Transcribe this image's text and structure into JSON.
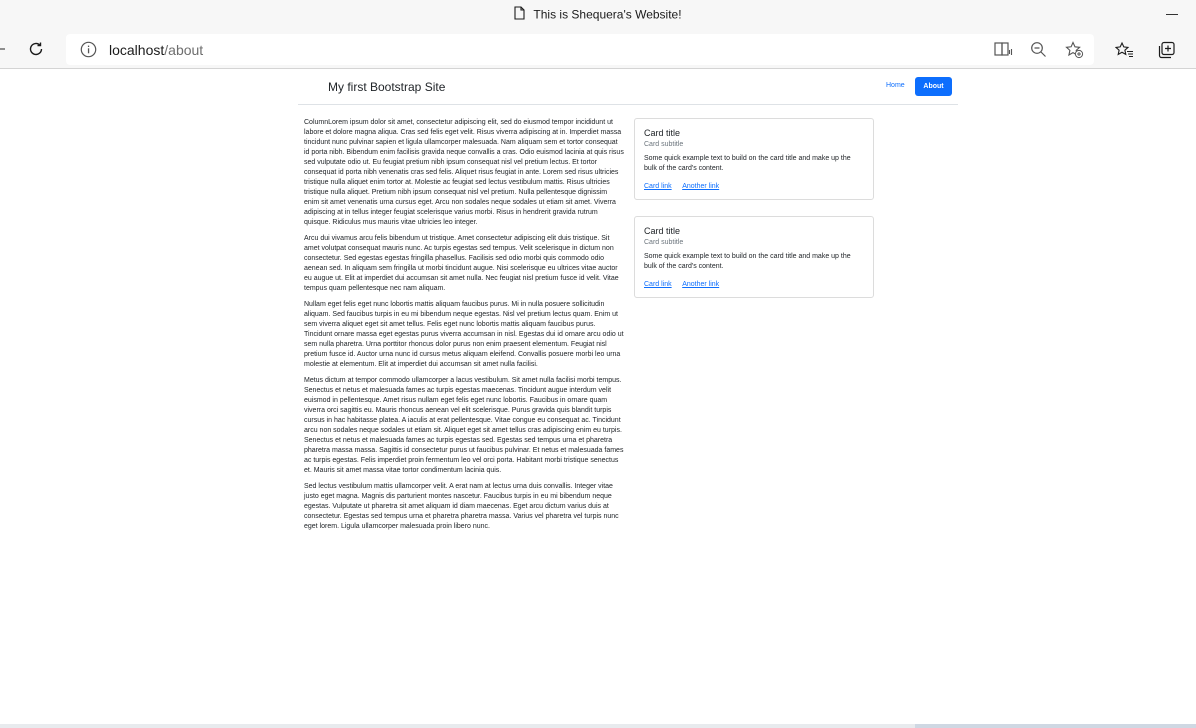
{
  "browser": {
    "tab_title": "This is Shequera's Website!",
    "url_host": "localhost",
    "url_path": "/about"
  },
  "navbar": {
    "brand": "My first Bootstrap Site",
    "home": "Home",
    "about": "About"
  },
  "content": {
    "paragraphs": [
      "ColumnLorem ipsum dolor sit amet, consectetur adipiscing elit, sed do eiusmod tempor incididunt ut labore et dolore magna aliqua. Cras sed felis eget velit. Risus viverra adipiscing at in. Imperdiet massa tincidunt nunc pulvinar sapien et ligula ullamcorper malesuada. Nam aliquam sem et tortor consequat id porta nibh. Bibendum enim facilisis gravida neque convallis a cras. Odio euismod lacinia at quis risus sed vulputate odio ut. Eu feugiat pretium nibh ipsum consequat nisl vel pretium lectus. Et tortor consequat id porta nibh venenatis cras sed felis. Aliquet risus feugiat in ante. Lorem sed risus ultricies tristique nulla aliquet enim tortor at. Molestie ac feugiat sed lectus vestibulum mattis. Risus ultricies tristique nulla aliquet. Pretium nibh ipsum consequat nisl vel pretium. Nulla pellentesque dignissim enim sit amet venenatis urna cursus eget. Arcu non sodales neque sodales ut etiam sit amet. Viverra adipiscing at in tellus integer feugiat scelerisque varius morbi. Risus in hendrerit gravida rutrum quisque. Ridiculus mus mauris vitae ultricies leo integer.",
      "Arcu dui vivamus arcu felis bibendum ut tristique. Amet consectetur adipiscing elit duis tristique. Sit amet volutpat consequat mauris nunc. Ac turpis egestas sed tempus. Velit scelerisque in dictum non consectetur. Sed egestas egestas fringilla phasellus. Facilisis sed odio morbi quis commodo odio aenean sed. In aliquam sem fringilla ut morbi tincidunt augue. Nisi scelerisque eu ultrices vitae auctor eu augue ut. Elit at imperdiet dui accumsan sit amet nulla. Nec feugiat nisl pretium fusce id velit. Vitae tempus quam pellentesque nec nam aliquam.",
      "Nullam eget felis eget nunc lobortis mattis aliquam faucibus purus. Mi in nulla posuere sollicitudin aliquam. Sed faucibus turpis in eu mi bibendum neque egestas. Nisl vel pretium lectus quam. Enim ut sem viverra aliquet eget sit amet tellus. Felis eget nunc lobortis mattis aliquam faucibus purus. Tincidunt ornare massa eget egestas purus viverra accumsan in nisl. Egestas dui id ornare arcu odio ut sem nulla pharetra. Urna porttitor rhoncus dolor purus non enim praesent elementum. Feugiat nisl pretium fusce id. Auctor urna nunc id cursus metus aliquam eleifend. Convallis posuere morbi leo urna molestie at elementum. Elit at imperdiet dui accumsan sit amet nulla facilisi.",
      "Metus dictum at tempor commodo ullamcorper a lacus vestibulum. Sit amet nulla facilisi morbi tempus. Senectus et netus et malesuada fames ac turpis egestas maecenas. Tincidunt augue interdum velit euismod in pellentesque. Amet risus nullam eget felis eget nunc lobortis. Faucibus in ornare quam viverra orci sagittis eu. Mauris rhoncus aenean vel elit scelerisque. Purus gravida quis blandit turpis cursus in hac habitasse platea. A iaculis at erat pellentesque. Vitae congue eu consequat ac. Tincidunt arcu non sodales neque sodales ut etiam sit. Aliquet eget sit amet tellus cras adipiscing enim eu turpis. Senectus et netus et malesuada fames ac turpis egestas sed. Egestas sed tempus urna et pharetra pharetra massa massa. Sagittis id consectetur purus ut faucibus pulvinar. Et netus et malesuada fames ac turpis egestas. Felis imperdiet proin fermentum leo vel orci porta. Habitant morbi tristique senectus et. Mauris sit amet massa vitae tortor condimentum lacinia quis.",
      "Sed lectus vestibulum mattis ullamcorper velit. A erat nam at lectus urna duis convallis. Integer vitae justo eget magna. Magnis dis parturient montes nascetur. Faucibus turpis in eu mi bibendum neque egestas. Vulputate ut pharetra sit amet aliquam id diam maecenas. Eget arcu dictum varius duis at consectetur. Egestas sed tempus urna et pharetra pharetra massa. Varius vel pharetra vel turpis nunc eget lorem. Ligula ullamcorper malesuada proin libero nunc."
    ]
  },
  "cards": [
    {
      "title": "Card title",
      "subtitle": "Card subtitle",
      "text": "Some quick example text to build on the card title and make up the bulk of the card's content.",
      "link1": "Card link",
      "link2": "Another link"
    },
    {
      "title": "Card title",
      "subtitle": "Card subtitle",
      "text": "Some quick example text to build on the card title and make up the bulk of the card's content.",
      "link1": "Card link",
      "link2": "Another link"
    }
  ],
  "icons": {
    "page": "page-icon",
    "refresh": "refresh-icon",
    "info": "info-icon",
    "read_aloud": "immersive-reader-icon",
    "zoom": "zoom-out-icon",
    "favorite": "add-favorite-icon",
    "favorites": "favorites-icon",
    "collections": "collections-icon"
  }
}
